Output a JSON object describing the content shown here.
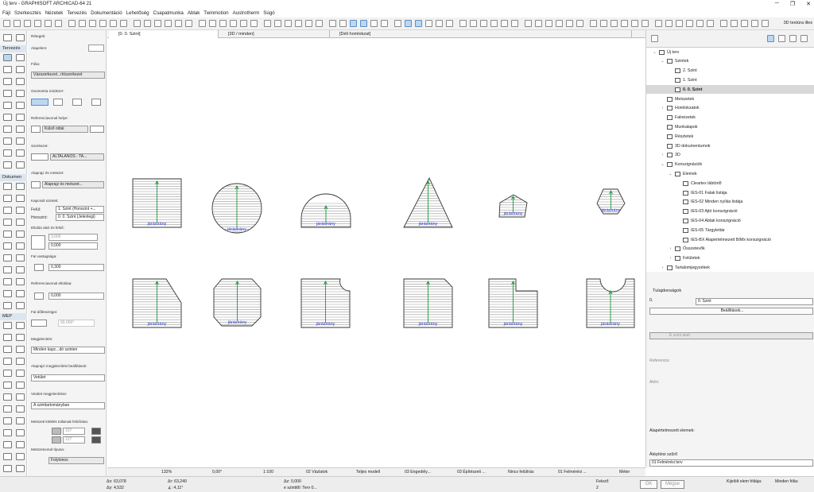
{
  "window": {
    "title": "Új terv - GRAPHISOFT ARCHICAD-64 21",
    "controls": [
      "─",
      "❐",
      "✕"
    ]
  },
  "menu": [
    "Fájl",
    "Szerkesztés",
    "Nézetek",
    "Tervezés",
    "Dokumentáció",
    "Lehetőség",
    "Csapatmunka",
    "Ablak",
    "Twinmotion",
    "Austrotherm",
    "Súgó"
  ],
  "toolbar": {
    "texture_label": "3D textúra illes"
  },
  "toolbox": {
    "sections": [
      "Tervezés",
      "Dokumen",
      "MEP"
    ]
  },
  "infobox": {
    "floor_label": "Rétegek:",
    "base_label": "Alapelem:",
    "layer_label": "Fólia:",
    "layer_value": "Vázszerkezet...rtószerkezet",
    "geometry_label": "Geometria módszer:",
    "refline_label": "Referenciavonal helye:",
    "refline_value": "Külső oldal",
    "structure_label": "Szerkezet:",
    "structure_value": "ÁLTALÁNOS - TA...",
    "plan_section_label": "Alaprajz és metszet:",
    "plan_section_value": "Alaprajz és metszet...",
    "link_label": "Kapcsolt szintek:",
    "top_label": "Felül:",
    "top_value": "1. Szint (Honszint +...",
    "home_label": "Honszint:",
    "home_value": "0. 0. Szint (Jelenlegi)",
    "offset_label": "Eltolás alsó és felső:",
    "offset_top": "3,000",
    "offset_bottom": "0,000",
    "thickness_label": "Fal vastagsága:",
    "thickness_value": "0,300",
    "refoffset_label": "Referenciavonal eltolása:",
    "refoffset_value": "0,000",
    "slant_label": "Fal dőlésszögei:",
    "slant_value": "90,000°",
    "show_label": "Megjelenítés:",
    "show_value": "Minden kapc...dó szinten",
    "plan_show_label": "Alaprajzi megjelenítési beállítások:",
    "plan_show_value": "Vetület",
    "proj_show_label": "Vetület megjelenítése:",
    "proj_show_value": "A szinttartományban",
    "fill_label": "Metszeti kitöltés tollainak felülírása:",
    "fill_pen1": "107",
    "fill_pen2": "127",
    "contour_label": "Metszetvonal típusa:",
    "contour_value": "Folytonos"
  },
  "tabs": [
    "[0. 0. Szint]",
    "[3D / minden]",
    "[Déli homlokzat]"
  ],
  "canvas": {
    "direction_label": "járásirány"
  },
  "navigator": {
    "tree": [
      {
        "label": "Új terv",
        "depth": 0,
        "tw": "⌄",
        "sel": false
      },
      {
        "label": "Szintek",
        "depth": 1,
        "tw": "⌄",
        "sel": false
      },
      {
        "label": "2. Szint",
        "depth": 2,
        "tw": "",
        "sel": false
      },
      {
        "label": "1. Szint",
        "depth": 2,
        "tw": "",
        "sel": false
      },
      {
        "label": "0. 0. Szint",
        "depth": 2,
        "tw": "",
        "sel": true
      },
      {
        "label": "Metszetek",
        "depth": 1,
        "tw": "",
        "sel": false
      },
      {
        "label": "Homlokzatok",
        "depth": 1,
        "tw": "›",
        "sel": false
      },
      {
        "label": "Falnézetek",
        "depth": 1,
        "tw": "",
        "sel": false
      },
      {
        "label": "Munkalapok",
        "depth": 1,
        "tw": "",
        "sel": false
      },
      {
        "label": "Részletek",
        "depth": 1,
        "tw": "",
        "sel": false
      },
      {
        "label": "3D dokumentumok",
        "depth": 1,
        "tw": "",
        "sel": false
      },
      {
        "label": "3D",
        "depth": 1,
        "tw": "›",
        "sel": false
      },
      {
        "label": "Konszignációk",
        "depth": 1,
        "tw": "⌄",
        "sel": false
      },
      {
        "label": "Elemek",
        "depth": 2,
        "tw": "⌄",
        "sel": false
      },
      {
        "label": "Cleartex lábtörlő",
        "depth": 3,
        "tw": "",
        "sel": false
      },
      {
        "label": "IES-01 Falak listája",
        "depth": 3,
        "tw": "",
        "sel": false
      },
      {
        "label": "IES-02 Minden nyílás listája",
        "depth": 3,
        "tw": "",
        "sel": false
      },
      {
        "label": "IES-03 Ajtó konszignáció",
        "depth": 3,
        "tw": "",
        "sel": false
      },
      {
        "label": "IES-04 Ablak konszignáció",
        "depth": 3,
        "tw": "",
        "sel": false
      },
      {
        "label": "IES-05 Tárgylettár",
        "depth": 3,
        "tw": "",
        "sel": false
      },
      {
        "label": "IES-BX Alapértelmezett BIMx konszignáció",
        "depth": 3,
        "tw": "",
        "sel": false
      },
      {
        "label": "Összetevők",
        "depth": 2,
        "tw": "›",
        "sel": false
      },
      {
        "label": "Felületek",
        "depth": 2,
        "tw": "›",
        "sel": false
      },
      {
        "label": "Tartalomjegyzékek",
        "depth": 1,
        "tw": "›",
        "sel": false
      }
    ]
  },
  "properties": {
    "title": "Tulajdonságok",
    "id_label": "0.",
    "id_value": "0. Szint",
    "settings_button": "Beállítások...",
    "level_label": "E szint alatt",
    "reference_label": "Referencia:",
    "active_label": "Aktív:",
    "default_elements_label": "Alapértelmezett elemek:",
    "filter_label": "Átépítési szűrő",
    "filter_value": "01 Felmérési terv"
  },
  "status": {
    "zoom": "132%",
    "angle": "0,00°",
    "scale": "1:100",
    "layer_combo": "02 Vázlatok",
    "model": "Teljes modell",
    "override": "03 Engedély...",
    "structure": "03 Építészeti ...",
    "renovation": "Nincs felülírás",
    "filter": "01 Felmérési ...",
    "units": "Méter"
  },
  "coords": {
    "ax": "Δx: 63,078",
    "ay": "Δy: 4,532",
    "ar": "Δr: 63,240",
    "aangle": "∡: 4,11°",
    "az": "Δz: 0,000",
    "az_ref": "e szinttől: Terv 0...",
    "snap": "Felező",
    "snap_num": "2",
    "ok": "OK",
    "cancel": "Mégse",
    "sel_label": "Kijelölt elem fóliája:",
    "all_label": "Minden fólia:"
  }
}
